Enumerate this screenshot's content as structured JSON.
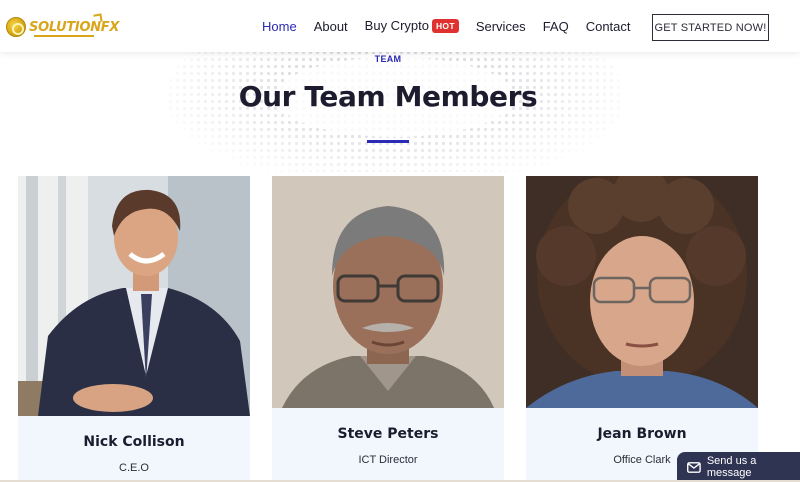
{
  "brand": {
    "logo_text": "SOLUTIONFX"
  },
  "nav": {
    "items": [
      {
        "label": "Home",
        "active": true
      },
      {
        "label": "About",
        "active": false
      },
      {
        "label": "Buy Crypto",
        "active": false,
        "badge": "HOT"
      },
      {
        "label": "Services",
        "active": false
      },
      {
        "label": "FAQ",
        "active": false
      },
      {
        "label": "Contact",
        "active": false
      }
    ],
    "cta_label": "GET STARTED NOW!"
  },
  "section": {
    "eyebrow": "TEAM",
    "title": "Our Team Members"
  },
  "team": [
    {
      "name": "Nick Collison",
      "role": "C.E.O"
    },
    {
      "name": "Steve Peters",
      "role": "ICT Director"
    },
    {
      "name": "Jean Brown",
      "role": "Office Clark"
    }
  ],
  "chat": {
    "label": "Send us a message"
  },
  "colors": {
    "accent": "#2b2bb5",
    "hot_badge": "#e03131",
    "brand_gold": "#d9a51a",
    "card_info_bg": "#f2f7fd",
    "chat_bg": "#2e3452"
  }
}
